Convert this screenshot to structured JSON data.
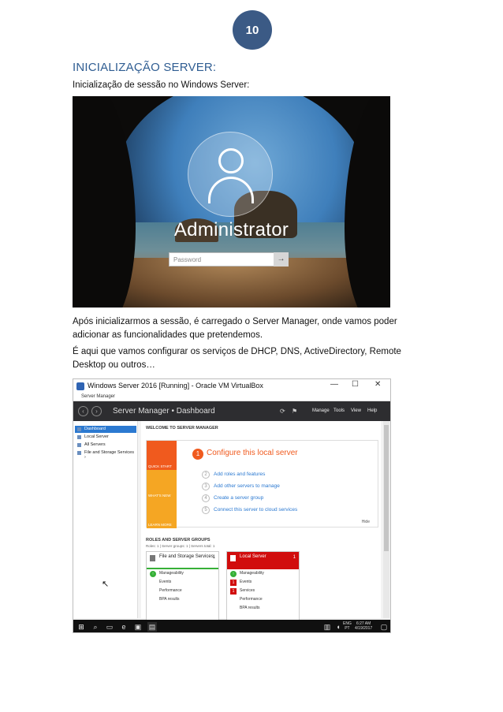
{
  "page": {
    "number": "10",
    "title": "INICIALIZAÇÃO SERVER:",
    "intro": "Inicialização de sessão no Windows Server:",
    "para_after_login": "Após inicializarmos a sessão, é carregado o Server Manager, onde vamos poder adicionar as funcionalidades que pretendemos.",
    "para_services": "É aqui que vamos configurar os serviços de DHCP, DNS, ActiveDirectory, Remote Desktop ou outros…"
  },
  "login_screen": {
    "user_name": "Administrator",
    "password_placeholder": "Password",
    "submit_icon": "arrow-right-icon"
  },
  "virtualbox": {
    "window_title": "Windows Server 2016 [Running] - Oracle VM VirtualBox",
    "controls": [
      "—",
      "☐",
      "✕"
    ],
    "app_strip": "Server Manager",
    "breadcrumb": "Server Manager • Dashboard",
    "menu": [
      "Manage",
      "Tools",
      "View",
      "Help"
    ],
    "sidebar": [
      {
        "label": "Dashboard",
        "active": true
      },
      {
        "label": "Local Server",
        "active": false
      },
      {
        "label": "All Servers",
        "active": false
      },
      {
        "label": "File and Storage Services",
        "active": false
      }
    ],
    "welcome_title": "WELCOME TO SERVER MANAGER",
    "quick_start": {
      "blocks": [
        "QUICK START",
        "WHAT'S NEW",
        "LEARN MORE"
      ],
      "configure_number": "1",
      "configure_label": "Configure this local server",
      "items": [
        {
          "num": "2",
          "label": "Add roles and features"
        },
        {
          "num": "3",
          "label": "Add other servers to manage"
        },
        {
          "num": "4",
          "label": "Create a server group"
        },
        {
          "num": "5",
          "label": "Connect this server to cloud services"
        }
      ],
      "hide": "Hide"
    },
    "roles": {
      "title": "ROLES AND SERVER GROUPS",
      "subtitle": "Roles: 1 | Server groups: 1 | Servers total: 1",
      "tiles": [
        {
          "name": "File and Storage Services",
          "count": "1",
          "rows": [
            {
              "label": "Manageability",
              "status": "ok"
            },
            {
              "label": "Events",
              "status": "none"
            },
            {
              "label": "Performance",
              "status": "none"
            },
            {
              "label": "BPA results",
              "status": "none"
            }
          ]
        },
        {
          "name": "Local Server",
          "count": "1",
          "rows": [
            {
              "label": "Manageability",
              "status": "ok"
            },
            {
              "label": "Events",
              "status": "bad"
            },
            {
              "label": "Services",
              "status": "bad"
            },
            {
              "label": "Performance",
              "status": "none"
            },
            {
              "label": "BPA results",
              "status": "none"
            }
          ]
        }
      ]
    },
    "taskbar": {
      "lang": "ENG",
      "locale": "PT",
      "time": "6:27 AM",
      "date": "4/19/2017"
    }
  },
  "colors": {
    "badge": "#3b5a85",
    "title": "#2f5d92",
    "accent_orange": "#f05a1e",
    "tile_red": "#d10d0d",
    "link_blue": "#2b79d1"
  }
}
